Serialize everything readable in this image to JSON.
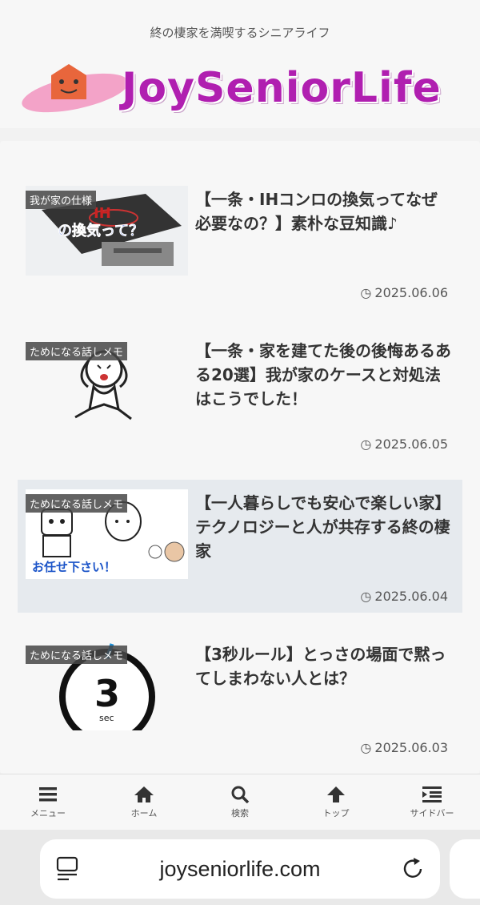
{
  "header": {
    "tagline": "終の棲家を満喫するシニアライフ",
    "logo_text": "JoySeniorLife"
  },
  "posts": [
    {
      "category": "我が家の仕様",
      "title": "【一条・IHコンロの換気ってなぜ必要なの？】素朴な豆知識♪",
      "date": "2025.06.06",
      "thumb_text": "IH の換気って？"
    },
    {
      "category": "ためになる話しメモ",
      "title": "【一条・家を建てた後の後悔あるある20選】我が家のケースと対処法はこうでした！",
      "date": "2025.06.05"
    },
    {
      "category": "ためになる話しメモ",
      "title": "【一人暮らしでも安心で楽しい家】テクノロジーと人が共存する終の棲家",
      "date": "2025.06.04",
      "thumb_text": "お任せ下さい！"
    },
    {
      "category": "ためになる話しメモ",
      "title": "【3秒ルール】とっさの場面で黙ってしまわない人とは？",
      "date": "2025.06.03",
      "thumb_number": "3",
      "thumb_unit": "sec"
    }
  ],
  "bottom_nav": [
    {
      "label": "メニュー",
      "icon": "menu-icon"
    },
    {
      "label": "ホーム",
      "icon": "home-icon"
    },
    {
      "label": "検索",
      "icon": "search-icon"
    },
    {
      "label": "トップ",
      "icon": "arrow-up-icon"
    },
    {
      "label": "サイドバー",
      "icon": "sidebar-icon"
    }
  ],
  "browser": {
    "url": "joyseniorlife.com"
  },
  "colors": {
    "logo": "#b01fb0",
    "active_post_bg": "#e6eaee",
    "category_bg": "#464646"
  }
}
